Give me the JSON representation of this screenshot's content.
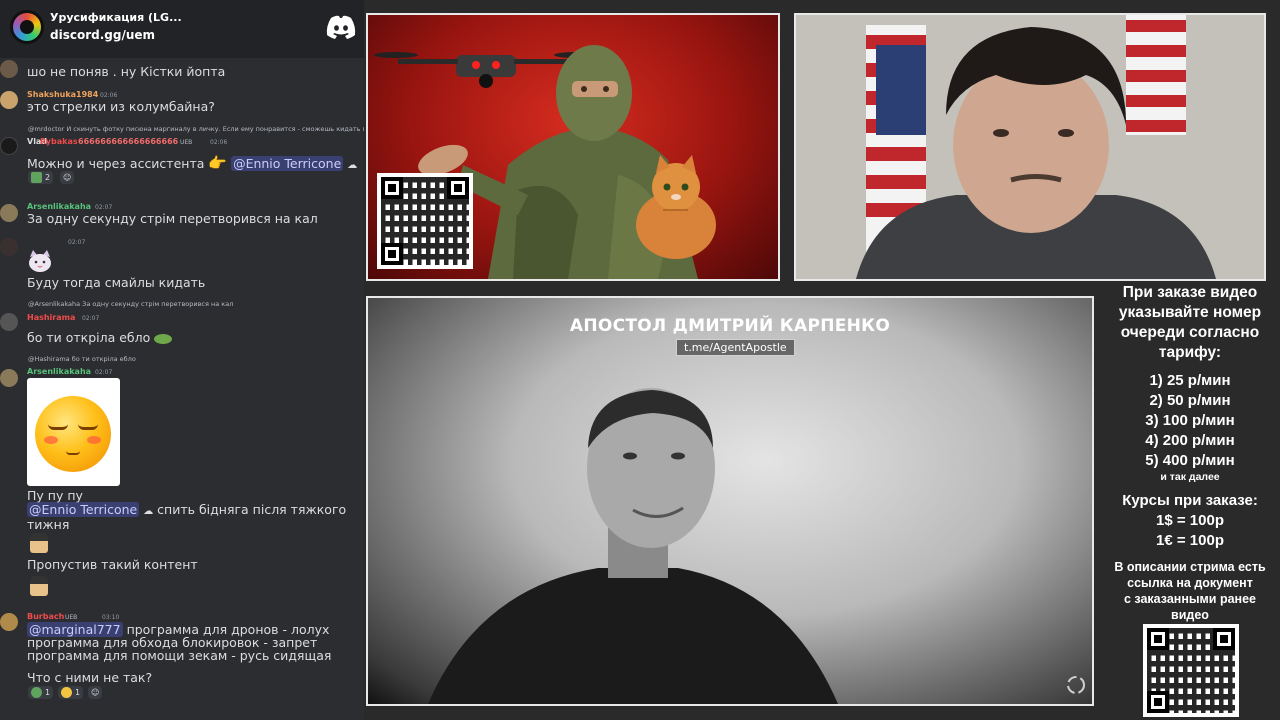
{
  "server": {
    "name": "Урусификация (LG...",
    "invite": "discord.gg/uem"
  },
  "chat": {
    "messages": [
      {
        "text": "шо не поняв . ну Кістки йопта"
      },
      {
        "user": "Shakshuka1984",
        "time": "02:06",
        "text": "это стрелки из колумбайна?"
      },
      {
        "reply": "@mrdoctor  И скинуть фотку писюна маргиналу в личку. Если ему понравится - сможешь кидать г",
        "user": "Vlad",
        "user2": "Rybakas",
        "digits": "666666666666666666",
        "badge": "UEB",
        "time": "02:06",
        "text": "Можно и через ассистента",
        "mention": "@Ennio Terricone",
        "react_count": "2"
      },
      {
        "user": "Arsenlikakaha",
        "time": "02:07",
        "text": "За одну секунду стрім перетворився на кал"
      },
      {
        "time": "02:07",
        "text": "Буду тогда смайлы кидать"
      },
      {
        "reply": "@Arsenlikakaha  За одну секунду стрім перетворився на кал",
        "user": "Hashirama",
        "time": "02:07",
        "text": "бо ти откріла ебло"
      },
      {
        "reply": "@Hashirama  бо ти откріла ебло",
        "user": "Arsenlikakaha",
        "time": "02:07",
        "text": "Пу пу пу",
        "mention": "@Ennio Terricone",
        "text2": "спить бідняга після тяжкого",
        "text3": "тижня"
      },
      {
        "text": "Пропустив такий контент"
      },
      {
        "user": "Burbach",
        "badge": "UEB",
        "time": "03:10",
        "mention": "@marginal777",
        "line1": "программа для дронов - лолух",
        "line2": "программа для обхода блокировок - запрет",
        "line3": "программа для помощи зекам - русь сидящая",
        "text": "Что с ними не так?",
        "react1": "1",
        "react2": "1"
      }
    ]
  },
  "video": {
    "title": "АПОСТОЛ ДМИТРИЙ КАРПЕНКО",
    "link": "t.me/AgentApostle"
  },
  "info": {
    "head": [
      "При заказе видео",
      "указывайте номер",
      "очереди согласно",
      "тарифу:"
    ],
    "tariffs": [
      "1) 25 р/мин",
      "2) 50 р/мин",
      "3) 100 р/мин",
      "4) 200 р/мин",
      "5) 400 р/мин"
    ],
    "etc": "и так далее",
    "rates_title": "Курсы при заказе:",
    "rates": [
      "1$ = 100р",
      "1€ = 100р"
    ],
    "note": [
      "В описании стрима есть",
      "ссылка на документ",
      "с заказанными ранее",
      "видео"
    ]
  },
  "colors": {
    "chat_bg": "#2b2d31",
    "mention": "#c9cdfb",
    "user_orange": "#f0a35c",
    "user_green": "#57c27a",
    "user_red": "#f04b4b"
  }
}
